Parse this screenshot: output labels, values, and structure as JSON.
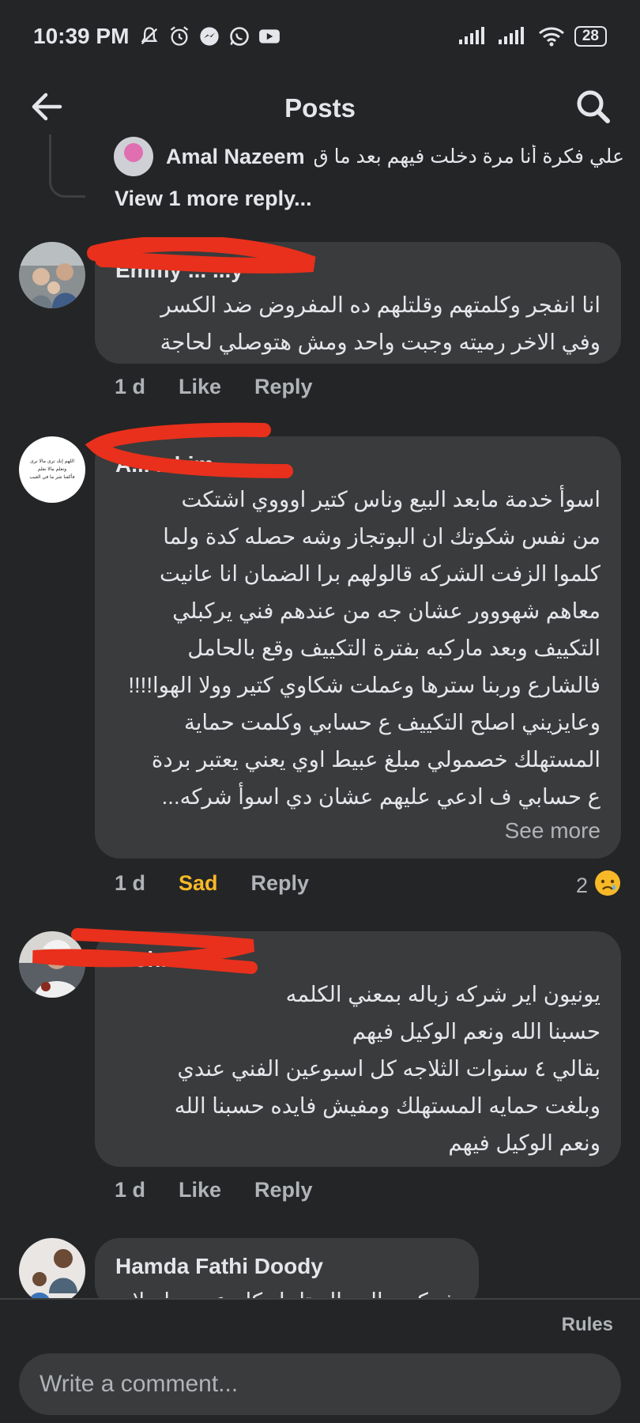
{
  "status_bar": {
    "time": "10:39 PM",
    "battery": "28",
    "icons": [
      "mute-icon",
      "alarm-icon",
      "messenger-icon",
      "whatsapp-icon",
      "youtube-icon",
      "signal-icon",
      "signal-icon",
      "wifi-icon"
    ]
  },
  "header": {
    "title": "Posts",
    "back_icon": "back-arrow-icon",
    "search_icon": "search-icon"
  },
  "reply_preview": {
    "name": "Amal Nazeem",
    "text": "علي فكرة أنا مرة دخلت فيهم بعد ما ق...",
    "view_more": "View 1 more reply..."
  },
  "comments": [
    {
      "name": "Emmy ... ...y",
      "lines": [
        "انا انفجر وكلمتهم وقلتلهم ده المفروض ضد الكسر",
        "وفي الاخر رميته وجبت واحد ومش هتوصلي لحاجة"
      ],
      "time": "1 d",
      "like_label": "Like",
      "reply_label": "Reply"
    },
    {
      "name": "A... ...him",
      "lines": [
        "اسوأ خدمة مابعد البيع وناس كتير اوووي اشتكت",
        "من نفس شكوتك ان البوتجاز وشه حصله كدة ولما",
        "كلموا الزفت الشركه قالولهم برا الضمان انا عانيت",
        "معاهم شهووور عشان جه من عندهم فني يركبلي",
        "التكييف وبعد ماركبه بفترة التكييف وقع بالحامل",
        "فالشارع وربنا سترها وعملت شكاوي كتير وولا الهوا!!!!",
        "وعايزيني اصلح التكييف ع حسابي وكلمت حماية",
        "المستهلك خصمولي مبلغ عبيط اوي يعني يعتبر بردة",
        "ع حسابي ف ادعي عليهم عشان دي اسوأ شركه..."
      ],
      "see_more": "See more",
      "time": "1 d",
      "reaction_label": "Sad",
      "reply_label": "Reply",
      "reaction_count": "2"
    },
    {
      "name": "Moh... ...er",
      "lines": [
        "يونيون اير شركه زباله بمعني الكلمه",
        "حسبنا الله ونعم الوكيل فيهم",
        "بقالي ٤ سنوات الثلاجه كل اسبوعين الفني عندي",
        "وبلغت حمايه المستهلك ومفيش فايده  حسبنا الله",
        "ونعم الوكيل فيهم"
      ],
      "time": "1 d",
      "like_label": "Like",
      "reply_label": "Reply"
    },
    {
      "name": "Hamda Fathi Doody",
      "lines": [
        "شركه زباله والبوتاجاز كله عيوب اصلا"
      ]
    }
  ],
  "avatar_2_text": [
    "اللهم إنك ترى مالا نرى",
    "وتعلم مالا نعلم",
    "فأكفنا شر ما في الغيب"
  ],
  "footer": {
    "rules_label": "Rules",
    "comment_placeholder": "Write a comment..."
  },
  "colors": {
    "background": "#242526",
    "bubble": "#3a3b3c",
    "text": "#e4e6eb",
    "muted": "#b0b3b8",
    "sad": "#f7b928",
    "scribble": "#e8301c"
  }
}
